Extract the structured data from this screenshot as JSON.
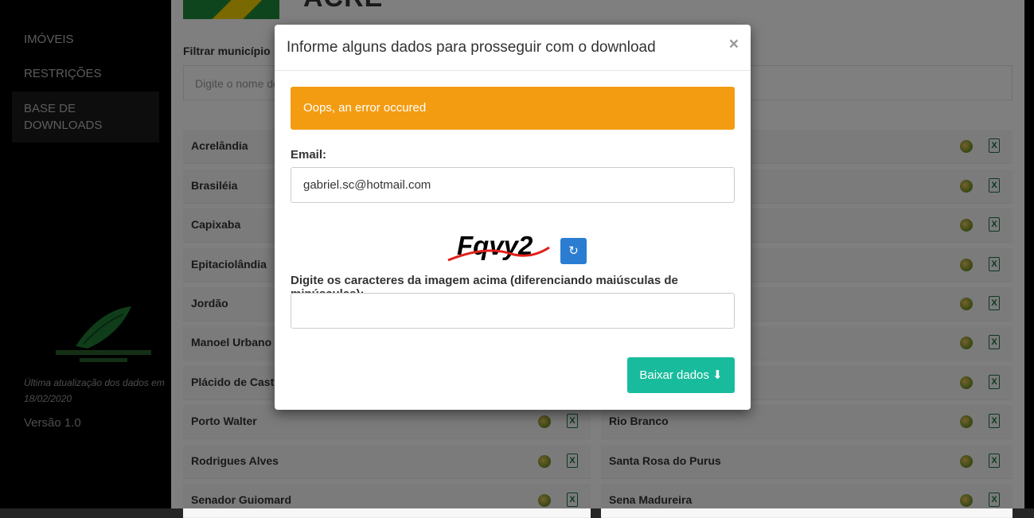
{
  "sidebar": {
    "items": [
      {
        "label": "IMÓVEIS"
      },
      {
        "label": "RESTRIÇÕES"
      },
      {
        "label": "BASE DE DOWNLOADS"
      }
    ],
    "updated_text": "Última atualização dos dados em 18/02/2020",
    "version": "Versão 1.0"
  },
  "page": {
    "state_title": "ACRE",
    "filter_label": "Filtrar município",
    "filter_placeholder": "Digite o nome do município",
    "municipalities_left": [
      "Acrelândia",
      "Brasiléia",
      "Capixaba",
      "Epitaciolândia",
      "Jordão",
      "Manoel Urbano",
      "Plácido de Castro",
      "Porto Walter",
      "Rodrigues Alves",
      "Senador Guiomard"
    ],
    "municipalities_right": [
      "Rio Branco",
      "Santa Rosa do Purus",
      "Sena Madureira"
    ]
  },
  "modal": {
    "title": "Informe alguns dados para prosseguir com o download",
    "close_label": "×",
    "alert": "Oops, an error occured",
    "email_label": "Email:",
    "email_value": "gabriel.sc@hotmail.com",
    "captcha_text": "Fqvy2",
    "refresh_icon": "↻",
    "captcha_label": "Digite os caracteres da imagem acima (diferenciando maiúsculas de minúsculas):",
    "captcha_value": "",
    "download_label": "Baixar dados",
    "download_icon": "⬇"
  },
  "colors": {
    "alert": "#f39c12",
    "refresh": "#2a7dd1",
    "download": "#18bc9c"
  }
}
